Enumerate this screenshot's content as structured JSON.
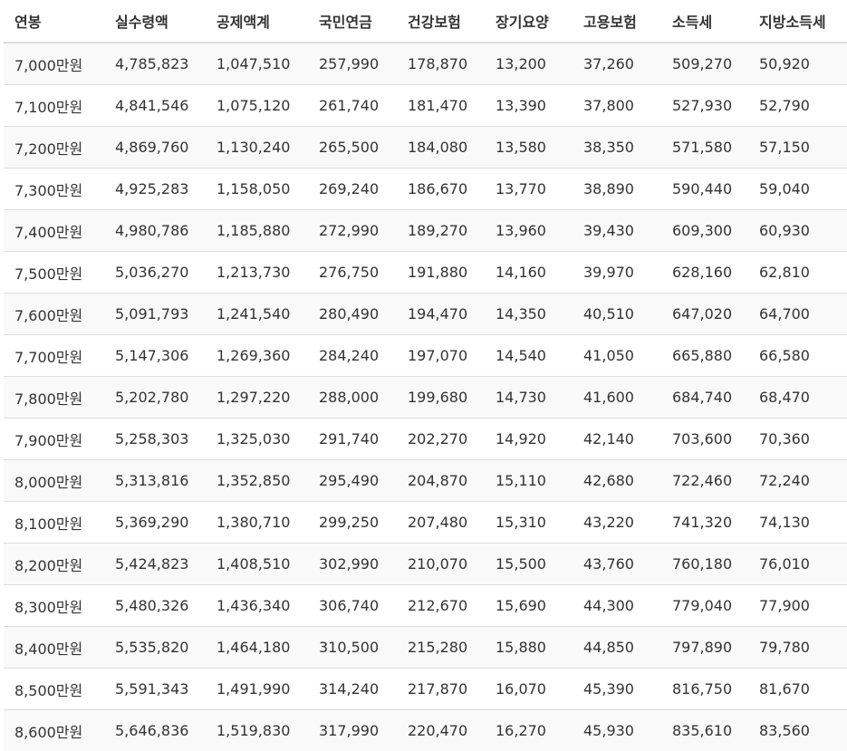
{
  "table": {
    "headers": [
      "연봉",
      "실수령액",
      "공제액계",
      "국민연금",
      "건강보험",
      "장기요양",
      "고용보험",
      "소득세",
      "지방소득세"
    ],
    "rows": [
      [
        "7,000만원",
        "4,785,823",
        "1,047,510",
        "257,990",
        "178,870",
        "13,200",
        "37,260",
        "509,270",
        "50,920"
      ],
      [
        "7,100만원",
        "4,841,546",
        "1,075,120",
        "261,740",
        "181,470",
        "13,390",
        "37,800",
        "527,930",
        "52,790"
      ],
      [
        "7,200만원",
        "4,869,760",
        "1,130,240",
        "265,500",
        "184,080",
        "13,580",
        "38,350",
        "571,580",
        "57,150"
      ],
      [
        "7,300만원",
        "4,925,283",
        "1,158,050",
        "269,240",
        "186,670",
        "13,770",
        "38,890",
        "590,440",
        "59,040"
      ],
      [
        "7,400만원",
        "4,980,786",
        "1,185,880",
        "272,990",
        "189,270",
        "13,960",
        "39,430",
        "609,300",
        "60,930"
      ],
      [
        "7,500만원",
        "5,036,270",
        "1,213,730",
        "276,750",
        "191,880",
        "14,160",
        "39,970",
        "628,160",
        "62,810"
      ],
      [
        "7,600만원",
        "5,091,793",
        "1,241,540",
        "280,490",
        "194,470",
        "14,350",
        "40,510",
        "647,020",
        "64,700"
      ],
      [
        "7,700만원",
        "5,147,306",
        "1,269,360",
        "284,240",
        "197,070",
        "14,540",
        "41,050",
        "665,880",
        "66,580"
      ],
      [
        "7,800만원",
        "5,202,780",
        "1,297,220",
        "288,000",
        "199,680",
        "14,730",
        "41,600",
        "684,740",
        "68,470"
      ],
      [
        "7,900만원",
        "5,258,303",
        "1,325,030",
        "291,740",
        "202,270",
        "14,920",
        "42,140",
        "703,600",
        "70,360"
      ],
      [
        "8,000만원",
        "5,313,816",
        "1,352,850",
        "295,490",
        "204,870",
        "15,110",
        "42,680",
        "722,460",
        "72,240"
      ],
      [
        "8,100만원",
        "5,369,290",
        "1,380,710",
        "299,250",
        "207,480",
        "15,310",
        "43,220",
        "741,320",
        "74,130"
      ],
      [
        "8,200만원",
        "5,424,823",
        "1,408,510",
        "302,990",
        "210,070",
        "15,500",
        "43,760",
        "760,180",
        "76,010"
      ],
      [
        "8,300만원",
        "5,480,326",
        "1,436,340",
        "306,740",
        "212,670",
        "15,690",
        "44,300",
        "779,040",
        "77,900"
      ],
      [
        "8,400만원",
        "5,535,820",
        "1,464,180",
        "310,500",
        "215,280",
        "15,880",
        "44,850",
        "797,890",
        "79,780"
      ],
      [
        "8,500만원",
        "5,591,343",
        "1,491,990",
        "314,240",
        "217,870",
        "16,070",
        "45,390",
        "816,750",
        "81,670"
      ],
      [
        "8,600만원",
        "5,646,836",
        "1,519,830",
        "317,990",
        "220,470",
        "16,270",
        "45,930",
        "835,610",
        "83,560"
      ]
    ]
  }
}
